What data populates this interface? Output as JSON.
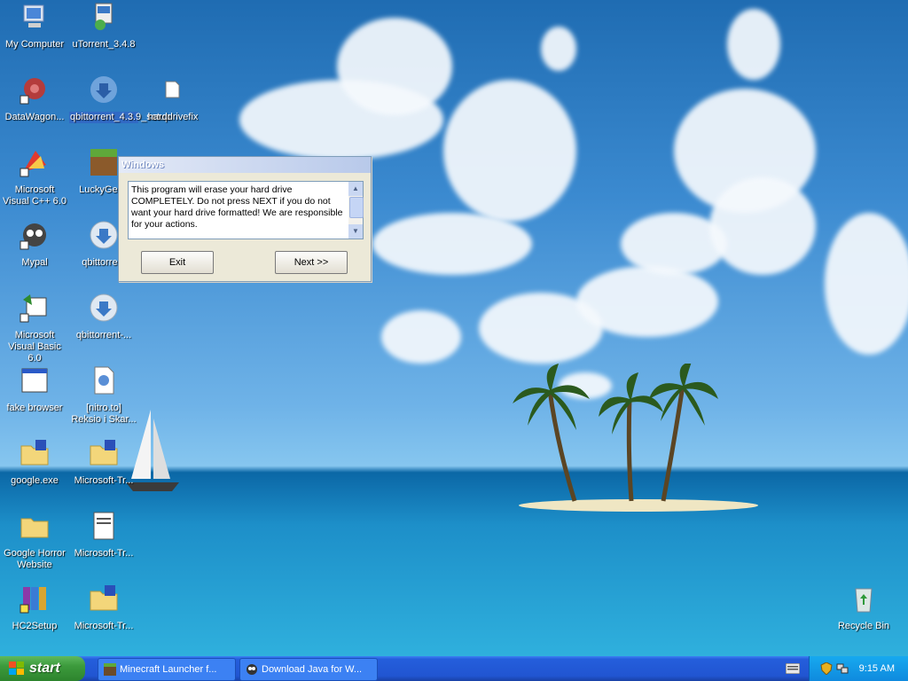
{
  "desktop": {
    "icons": [
      {
        "label": "My Computer",
        "icon": "my-computer-icon"
      },
      {
        "label": "uTorrent_3.4.8",
        "icon": "installer-icon"
      },
      {
        "label": "DataWagon...",
        "icon": "network-shortcut-icon"
      },
      {
        "label": "qbittorrent_4.3.9_setup",
        "icon": "qbittorrent-setup-icon"
      },
      {
        "label": "harddrivefix",
        "icon": "folder-icon"
      },
      {
        "label": "Microsoft Visual C++ 6.0",
        "icon": "visual-cpp-icon"
      },
      {
        "label": "LuckyGene",
        "icon": "minecraft-block-icon"
      },
      {
        "label": "Mypal",
        "icon": "mypal-browser-icon"
      },
      {
        "label": "qbittorrent",
        "icon": "qbittorrent-icon"
      },
      {
        "label": "Microsoft Visual Basic 6.0",
        "icon": "visual-basic-icon"
      },
      {
        "label": "qbittorrent-...",
        "icon": "qbittorrent-icon"
      },
      {
        "label": "fake browser",
        "icon": "window-app-icon"
      },
      {
        "label": "[nitro.to] Reksio i Skar...",
        "icon": "document-icon"
      },
      {
        "label": "google.exe",
        "icon": "zip-folder-icon"
      },
      {
        "label": "Microsoft-Tr...",
        "icon": "zip-folder-icon"
      },
      {
        "label": "Google Horror Website",
        "icon": "folder-icon"
      },
      {
        "label": "Microsoft-Tr...",
        "icon": "text-file-icon"
      },
      {
        "label": "HC2Setup",
        "icon": "winrar-icon"
      },
      {
        "label": "Microsoft-Tr...",
        "icon": "zip-folder-icon"
      },
      {
        "label": "Recycle Bin",
        "icon": "recycle-bin-icon"
      }
    ]
  },
  "dialog": {
    "title": "Windows",
    "message": "This program will erase your hard drive COMPLETELY. Do not press NEXT if you do not want your hard drive formatted! We are responsible for your actions.",
    "exit_label": "Exit",
    "next_label": "Next >>"
  },
  "taskbar": {
    "start_label": "start",
    "tasks": [
      {
        "label": "Minecraft Launcher f...",
        "icon": "minecraft-icon"
      },
      {
        "label": "Download Java for W...",
        "icon": "browser-icon"
      }
    ],
    "clock": "9:15 AM"
  },
  "colors": {
    "taskbar": "#245edc",
    "start": "#3c9a3c",
    "selection": "#316ac5"
  }
}
